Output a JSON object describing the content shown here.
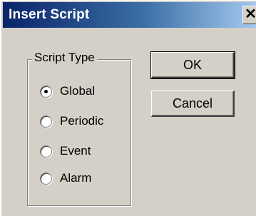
{
  "window": {
    "title": "Insert Script",
    "close_glyph": "✕"
  },
  "script_type": {
    "label": "Script Type",
    "options": [
      {
        "label": "Global",
        "selected": true
      },
      {
        "label": "Periodic",
        "selected": false
      },
      {
        "label": "Event",
        "selected": false
      },
      {
        "label": "Alarm",
        "selected": false
      }
    ]
  },
  "buttons": {
    "ok": "OK",
    "cancel": "Cancel"
  }
}
